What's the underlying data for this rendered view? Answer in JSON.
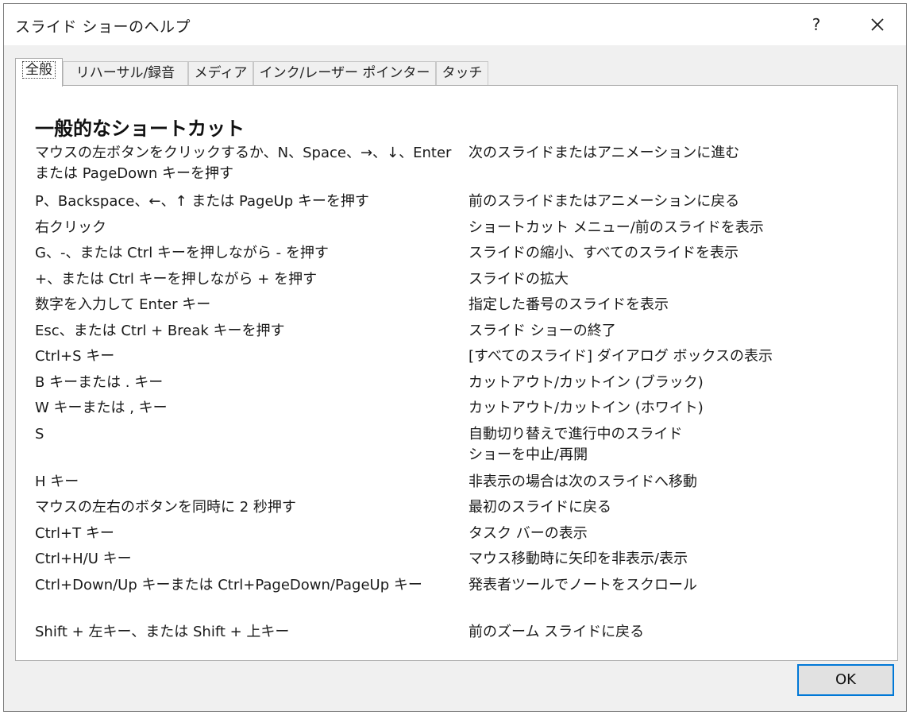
{
  "dialog": {
    "title": "スライド ショーのヘルプ",
    "help_label": "?",
    "close_icon": "close-icon",
    "ok_label": "OK"
  },
  "tabs": [
    {
      "label": "全般",
      "active": true
    },
    {
      "label": "リハーサル/録音",
      "active": false
    },
    {
      "label": "メディア",
      "active": false
    },
    {
      "label": "インク/レーザー ポインター",
      "active": false
    },
    {
      "label": "タッチ",
      "active": false
    }
  ],
  "panel": {
    "heading": "一般的なショートカット",
    "rows": [
      {
        "keys": "マウスの左ボタンをクリックするか、N、Space、→、↓、Enter または PageDown キーを押す",
        "action": "次のスライドまたはアニメーションに進む"
      },
      {
        "keys": "P、Backspace、←、↑ または PageUp キーを押す",
        "action": "前のスライドまたはアニメーションに戻る"
      },
      {
        "keys": "右クリック",
        "action": "ショートカット メニュー/前のスライドを表示"
      },
      {
        "keys": "G、-、または Ctrl キーを押しながら - を押す",
        "action": "スライドの縮小、すべてのスライドを表示"
      },
      {
        "keys": "+、または Ctrl キーを押しながら + を押す",
        "action": "スライドの拡大"
      },
      {
        "keys": "数字を入力して Enter キー",
        "action": "指定した番号のスライドを表示"
      },
      {
        "keys": "Esc、または Ctrl + Break キーを押す",
        "action": "スライド ショーの終了"
      },
      {
        "keys": "Ctrl+S キー",
        "action": "[すべてのスライド] ダイアログ ボックスの表示"
      },
      {
        "keys": "B キーまたは . キー",
        "action": "カットアウト/カットイン (ブラック)"
      },
      {
        "keys": "W キーまたは , キー",
        "action": "カットアウト/カットイン (ホワイト)"
      },
      {
        "keys": "S",
        "action": "自動切り替えで進行中のスライド ショーを中止/再開"
      },
      {
        "keys": "H キー",
        "action": "非表示の場合は次のスライドへ移動"
      },
      {
        "keys": "マウスの左右のボタンを同時に 2 秒押す",
        "action": "最初のスライドに戻る"
      },
      {
        "keys": "Ctrl+T キー",
        "action": "タスク バーの表示"
      },
      {
        "keys": "Ctrl+H/U キー",
        "action": "マウス移動時に矢印を非表示/表示"
      },
      {
        "keys": "Ctrl+Down/Up キーまたは Ctrl+PageDown/PageUp キー",
        "action": "発表者ツールでノートをスクロール"
      },
      {
        "keys": "Shift + 左キー、または Shift + 上キー",
        "action": "前のズーム スライドに戻る"
      }
    ]
  }
}
